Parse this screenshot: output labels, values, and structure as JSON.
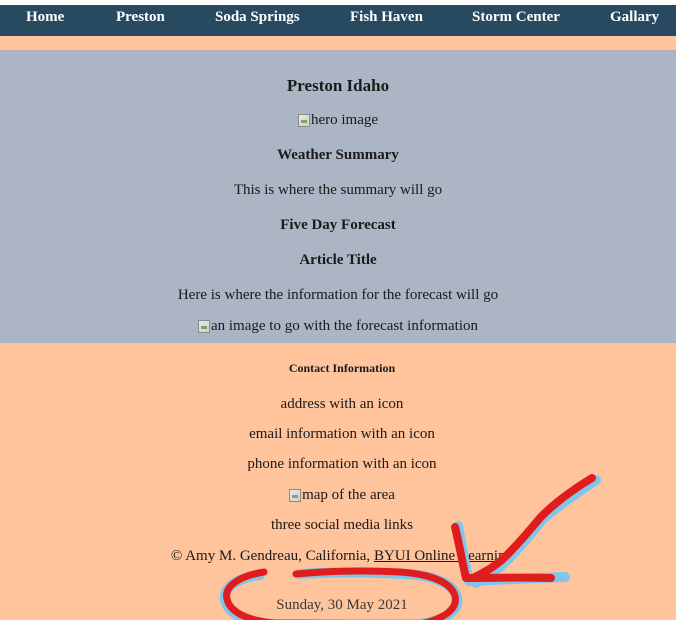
{
  "nav": {
    "items": [
      {
        "label": "Home"
      },
      {
        "label": "Preston"
      },
      {
        "label": "Soda Springs"
      },
      {
        "label": "Fish Haven"
      },
      {
        "label": "Storm Center"
      },
      {
        "label": "Gallary"
      }
    ]
  },
  "main": {
    "title": "Preston Idaho",
    "hero_alt": "hero image",
    "weather_heading": "Weather Summary",
    "weather_text": "This is where the summary will go",
    "forecast_heading": "Five Day Forecast",
    "article_heading": "Article Title",
    "article_text": "Here is where the information for the forecast will go",
    "article_image_alt": "an image to go with the forecast information"
  },
  "footer": {
    "heading": "Contact Information",
    "address": "address with an icon",
    "email": "email information with an icon",
    "phone": "phone information with an icon",
    "map_alt": "map of the area",
    "social": "three social media links",
    "copyright_prefix": "© Amy M. Gendreau, California, ",
    "copyright_link": "BYUI Online Learning",
    "date": "Sunday, 30 May 2021"
  },
  "colors": {
    "nav_bg": "#274a61",
    "main_bg": "#acb5c4",
    "page_bg": "#ffc49c",
    "annotation_red": "#e01c1c",
    "annotation_blue": "#7fc6ec"
  }
}
